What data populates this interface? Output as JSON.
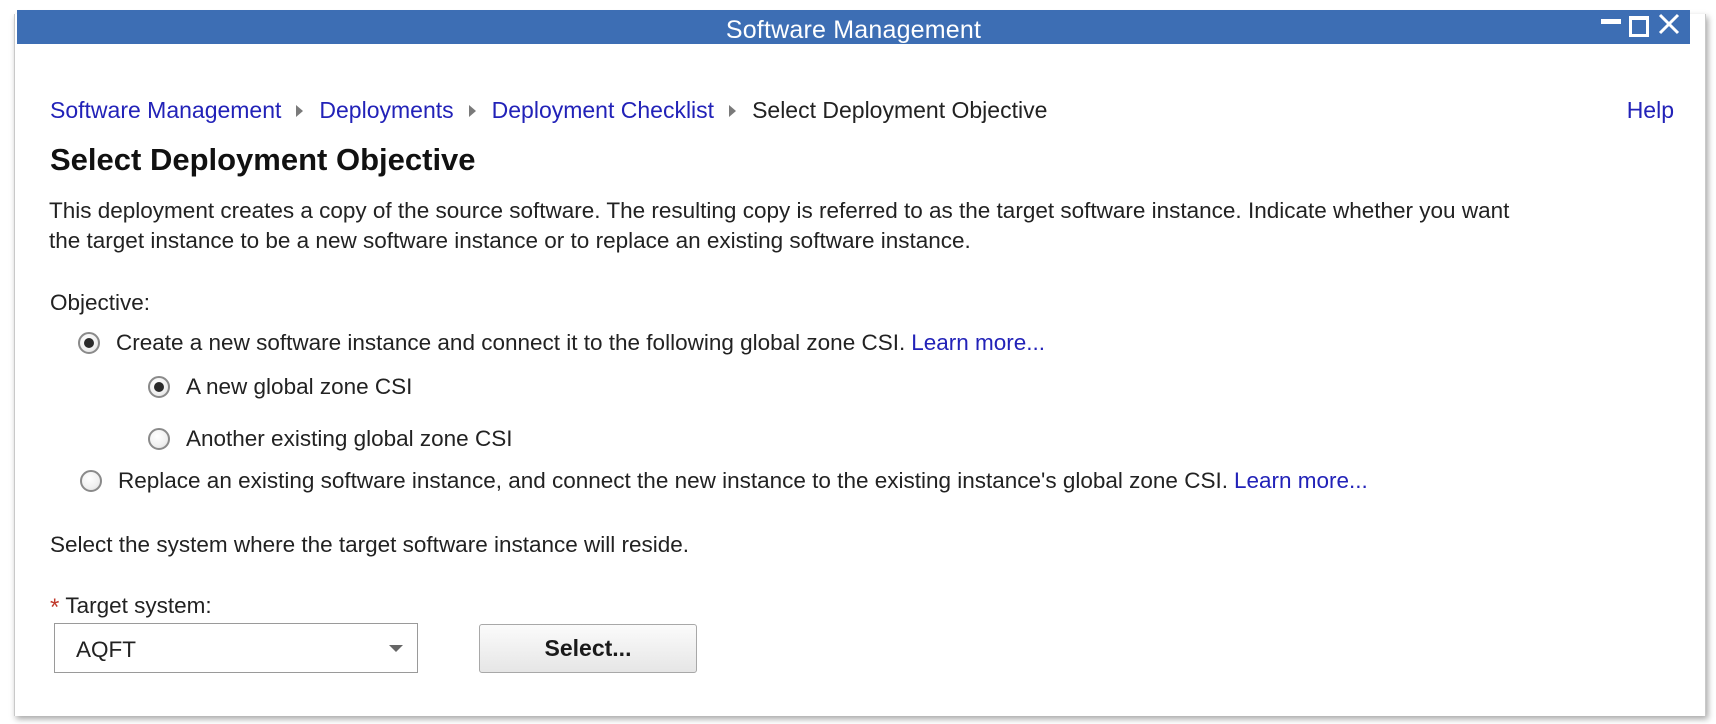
{
  "window": {
    "title": "Software Management"
  },
  "breadcrumb": {
    "items": [
      "Software Management",
      "Deployments",
      "Deployment Checklist"
    ],
    "current": "Select Deployment Objective"
  },
  "help_label": "Help",
  "page_title": "Select Deployment Objective",
  "description": {
    "line1": "This deployment creates a copy of the source software. The resulting copy is referred to as the target software instance. Indicate whether you want",
    "line2": "the target instance to be a new software instance or to replace an existing software instance."
  },
  "objective": {
    "label": "Objective:",
    "options": [
      {
        "label": "Create a new software instance and connect it to the following global zone CSI.",
        "learn_more": "Learn more...",
        "selected": true,
        "suboptions": [
          {
            "label": "A new global zone CSI",
            "selected": true
          },
          {
            "label": "Another existing global zone CSI",
            "selected": false
          }
        ]
      },
      {
        "label": "Replace an existing software instance, and connect the new instance to the existing instance's global zone CSI.",
        "learn_more": "Learn more...",
        "selected": false
      }
    ]
  },
  "target": {
    "instruction": "Select the system where the target software instance will reside.",
    "required_marker": "*",
    "label": "Target system:",
    "value": "AQFT",
    "select_button": "Select..."
  },
  "colors": {
    "titlebar": "#3d6eb4",
    "link": "#2222b8",
    "required": "#c0392b"
  },
  "icons": [
    "minimize-icon",
    "maximize-icon",
    "close-icon",
    "chevron-right-icon",
    "dropdown-caret-icon"
  ]
}
